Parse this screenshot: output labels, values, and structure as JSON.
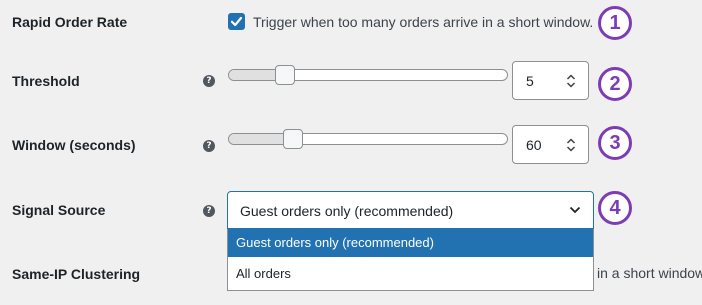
{
  "rows": {
    "rapid": {
      "label": "Rapid Order Rate",
      "checkbox_checked": true,
      "checkbox_text": "Trigger when too many orders arrive in a short window."
    },
    "threshold": {
      "label": "Threshold",
      "help": "?",
      "value": "5",
      "slider_fraction": 0.18
    },
    "window": {
      "label": "Window (seconds)",
      "help": "?",
      "value": "60",
      "slider_fraction": 0.21
    },
    "signal": {
      "label": "Signal Source",
      "help": "?",
      "selected": "Guest orders only (recommended)",
      "options": [
        "Guest orders only (recommended)",
        "All orders"
      ]
    },
    "sameip": {
      "label": "Same-IP Clustering",
      "suffix_text": "in a short window."
    }
  },
  "badges": [
    "1",
    "2",
    "3",
    "4"
  ],
  "colors": {
    "accent": "#2271b1",
    "badge": "#7d3cb5"
  }
}
